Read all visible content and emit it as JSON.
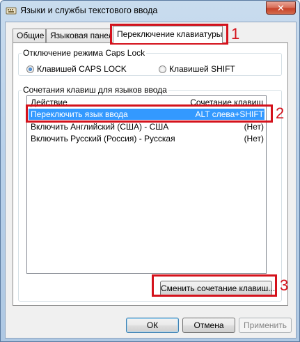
{
  "window": {
    "title": "Языки и службы текстового ввода",
    "close_label": "✕"
  },
  "tabs": [
    {
      "label": "Общие"
    },
    {
      "label": "Языковая панель"
    },
    {
      "label": "Переключение клавиатуры",
      "active": true
    }
  ],
  "caps_lock": {
    "legend": "Отключение режима Caps Lock",
    "option_capslock": "Клавишей CAPS LOCK",
    "option_shift": "Клавишей SHIFT",
    "selected": "option_capslock"
  },
  "hotkeys": {
    "legend": "Сочетания клавиш для языков ввода",
    "col_action": "Действие",
    "col_combo": "Сочетание клавиш",
    "rows": [
      {
        "action": "Переключить язык ввода",
        "combo": "ALT слева+SHIFT",
        "selected": true
      },
      {
        "action": "Включить Английский (США) - США",
        "combo": "(Нет)"
      },
      {
        "action": "Включить Русский (Россия) - Русская",
        "combo": "(Нет)"
      }
    ],
    "change_button": "Сменить сочетание клавиш..."
  },
  "footer": {
    "ok": "ОК",
    "cancel": "Отмена",
    "apply": "Применить"
  },
  "callouts": [
    "1",
    "2",
    "3"
  ],
  "colors": {
    "callout": "#d4121c",
    "selection": "#3399ff"
  }
}
